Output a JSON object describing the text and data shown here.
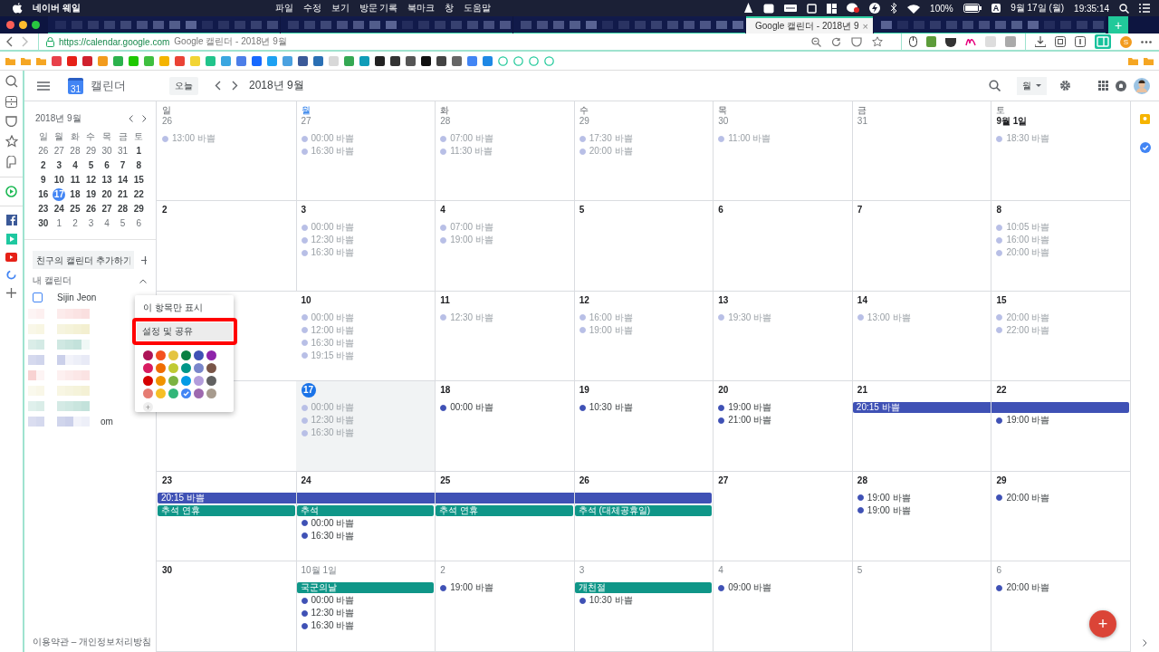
{
  "menubar": {
    "menus": [
      {
        "text": "네이버 웨일",
        "kind": "app"
      },
      {
        "text": "파일",
        "kind": "menu"
      },
      {
        "text": "수정",
        "kind": "menu"
      },
      {
        "text": "보기",
        "kind": "menu"
      },
      {
        "text": "방문 기록",
        "kind": "menu"
      },
      {
        "text": "북마크",
        "kind": "menu"
      },
      {
        "text": "창",
        "kind": "menu"
      },
      {
        "text": "도움말",
        "kind": "menu"
      }
    ],
    "battery": "100%",
    "input_source": "A",
    "date": "9월 17일 (월)",
    "time": "19:35:14"
  },
  "tabs": [
    {
      "kind": "blurred",
      "selected": false
    },
    {
      "kind": "blurred",
      "selected": false
    },
    {
      "kind": "blurred",
      "selected": false
    },
    {
      "kind": "page",
      "title": "Google 캘린더 - 2018년 9",
      "close": "×",
      "selected": true
    },
    {
      "kind": "blurred",
      "selected": false
    }
  ],
  "new_tab": "+",
  "address": {
    "url": "https://calendar.google.com",
    "title": "Google 캘린더 - 2018년 9월",
    "profile_initial": "S"
  },
  "header": {
    "logo_day": "31",
    "app_name": "캘린더",
    "today_button": "오늘",
    "period": "2018년 9월",
    "view": "월"
  },
  "mini_calendar": {
    "title": "2018년 9월",
    "weekdays": [
      "일",
      "월",
      "화",
      "수",
      "목",
      "금",
      "토"
    ],
    "days": [
      {
        "d": "26",
        "dim": true,
        "selected": false
      },
      {
        "d": "27",
        "dim": true,
        "selected": false
      },
      {
        "d": "28",
        "dim": true,
        "selected": false
      },
      {
        "d": "29",
        "dim": true,
        "selected": false
      },
      {
        "d": "30",
        "dim": true,
        "selected": false
      },
      {
        "d": "31",
        "dim": true,
        "selected": false
      },
      {
        "d": "1",
        "dim": false,
        "selected": false
      },
      {
        "d": "2",
        "dim": false,
        "selected": false
      },
      {
        "d": "3",
        "dim": false,
        "selected": false
      },
      {
        "d": "4",
        "dim": false,
        "selected": false
      },
      {
        "d": "5",
        "dim": false,
        "selected": false
      },
      {
        "d": "6",
        "dim": false,
        "selected": false
      },
      {
        "d": "7",
        "dim": false,
        "selected": false
      },
      {
        "d": "8",
        "dim": false,
        "selected": false
      },
      {
        "d": "9",
        "dim": false,
        "selected": false
      },
      {
        "d": "10",
        "dim": false,
        "selected": false
      },
      {
        "d": "11",
        "dim": false,
        "selected": false
      },
      {
        "d": "12",
        "dim": false,
        "selected": false
      },
      {
        "d": "13",
        "dim": false,
        "selected": false
      },
      {
        "d": "14",
        "dim": false,
        "selected": false
      },
      {
        "d": "15",
        "dim": false,
        "selected": false
      },
      {
        "d": "16",
        "dim": false,
        "selected": false
      },
      {
        "d": "17",
        "dim": false,
        "selected": true
      },
      {
        "d": "18",
        "dim": false,
        "selected": false
      },
      {
        "d": "19",
        "dim": false,
        "selected": false
      },
      {
        "d": "20",
        "dim": false,
        "selected": false
      },
      {
        "d": "21",
        "dim": false,
        "selected": false
      },
      {
        "d": "22",
        "dim": false,
        "selected": false
      },
      {
        "d": "23",
        "dim": false,
        "selected": false
      },
      {
        "d": "24",
        "dim": false,
        "selected": false
      },
      {
        "d": "25",
        "dim": false,
        "selected": false
      },
      {
        "d": "26",
        "dim": false,
        "selected": false
      },
      {
        "d": "27",
        "dim": false,
        "selected": false
      },
      {
        "d": "28",
        "dim": false,
        "selected": false
      },
      {
        "d": "29",
        "dim": false,
        "selected": false
      },
      {
        "d": "30",
        "dim": false,
        "selected": false
      },
      {
        "d": "1",
        "dim": true,
        "selected": false
      },
      {
        "d": "2",
        "dim": true,
        "selected": false
      },
      {
        "d": "3",
        "dim": true,
        "selected": false
      },
      {
        "d": "4",
        "dim": true,
        "selected": false
      },
      {
        "d": "5",
        "dim": true,
        "selected": false
      },
      {
        "d": "6",
        "dim": true,
        "selected": false
      }
    ]
  },
  "sidebar": {
    "add_friend_placeholder": "친구의 캘린더 추가하기",
    "my_calendars": "내 캘린더",
    "calendar": {
      "name": "Sijin Jeon",
      "checked": false
    },
    "trailing_text": "om",
    "footer": "이용약관 – 개인정보처리방침"
  },
  "popup": {
    "items": [
      {
        "text": "이 항목만 표시",
        "selected": false
      },
      {
        "text": "설정 및 공유",
        "selected": true
      }
    ],
    "colors": [
      {
        "color": "#ad1457",
        "selected": false
      },
      {
        "color": "#f4511e",
        "selected": false
      },
      {
        "color": "#e4c441",
        "selected": false
      },
      {
        "color": "#0b8043",
        "selected": false
      },
      {
        "color": "#3f51b5",
        "selected": false
      },
      {
        "color": "#8e24aa",
        "selected": false
      },
      {
        "color": "#d81b60",
        "selected": false
      },
      {
        "color": "#ef6c00",
        "selected": false
      },
      {
        "color": "#c0ca33",
        "selected": false
      },
      {
        "color": "#009688",
        "selected": false
      },
      {
        "color": "#7986cb",
        "selected": false
      },
      {
        "color": "#795548",
        "selected": false
      },
      {
        "color": "#d50000",
        "selected": false
      },
      {
        "color": "#f09300",
        "selected": false
      },
      {
        "color": "#7cb342",
        "selected": false
      },
      {
        "color": "#039be5",
        "selected": false
      },
      {
        "color": "#b39ddb",
        "selected": false
      },
      {
        "color": "#616161",
        "selected": false
      },
      {
        "color": "#e67c73",
        "selected": false
      },
      {
        "color": "#f6bf26",
        "selected": false
      },
      {
        "color": "#33b679",
        "selected": false
      },
      {
        "color": "#4285f4",
        "selected": true
      },
      {
        "color": "#9e69af",
        "selected": false
      },
      {
        "color": "#a79b8e",
        "selected": false
      }
    ],
    "add": "+"
  },
  "weekdays": [
    {
      "text": "일",
      "current": false
    },
    {
      "text": "월",
      "current": true
    },
    {
      "text": "화",
      "current": false
    },
    {
      "text": "수",
      "current": false
    },
    {
      "text": "목",
      "current": false
    },
    {
      "text": "금",
      "current": false
    },
    {
      "text": "토",
      "current": false
    }
  ],
  "weeks": [
    {
      "days": [
        {
          "date": "26",
          "dim": true,
          "today": false,
          "items": [
            {
              "kind": "event",
              "text": "13:00 바쁨",
              "faded": true
            }
          ]
        },
        {
          "date": "27",
          "dim": true,
          "today": false,
          "items": [
            {
              "kind": "event",
              "text": "00:00 바쁨",
              "faded": true
            },
            {
              "kind": "event",
              "text": "16:30 바쁨",
              "faded": true
            }
          ]
        },
        {
          "date": "28",
          "dim": true,
          "today": false,
          "items": [
            {
              "kind": "event",
              "text": "07:00 바쁨",
              "faded": true
            },
            {
              "kind": "event",
              "text": "11:30 바쁨",
              "faded": true
            }
          ]
        },
        {
          "date": "29",
          "dim": true,
          "today": false,
          "items": [
            {
              "kind": "event",
              "text": "17:30 바쁨",
              "faded": true
            },
            {
              "kind": "event",
              "text": "20:00 바쁨",
              "faded": true
            }
          ]
        },
        {
          "date": "30",
          "dim": true,
          "today": false,
          "items": [
            {
              "kind": "event",
              "text": "11:00 바쁨",
              "faded": true
            }
          ]
        },
        {
          "date": "31",
          "dim": true,
          "today": false
        },
        {
          "date": "9월 1일",
          "dim": false,
          "today": false,
          "items": [
            {
              "kind": "event",
              "text": "18:30 바쁨",
              "faded": true
            }
          ]
        }
      ]
    },
    {
      "days": [
        {
          "date": "2",
          "dim": false,
          "today": false
        },
        {
          "date": "3",
          "dim": false,
          "today": false,
          "items": [
            {
              "kind": "event",
              "text": "00:00 바쁨",
              "faded": true
            },
            {
              "kind": "event",
              "text": "12:30 바쁨",
              "faded": true
            },
            {
              "kind": "event",
              "text": "16:30 바쁨",
              "faded": true
            }
          ]
        },
        {
          "date": "4",
          "dim": false,
          "today": false,
          "items": [
            {
              "kind": "event",
              "text": "07:00 바쁨",
              "faded": true
            },
            {
              "kind": "event",
              "text": "19:00 바쁨",
              "faded": true
            }
          ]
        },
        {
          "date": "5",
          "dim": false,
          "today": false
        },
        {
          "date": "6",
          "dim": false,
          "today": false
        },
        {
          "date": "7",
          "dim": false,
          "today": false
        },
        {
          "date": "8",
          "dim": false,
          "today": false,
          "items": [
            {
              "kind": "event",
              "text": "10:05 바쁨",
              "faded": true
            },
            {
              "kind": "event",
              "text": "16:00 바쁨",
              "faded": true
            },
            {
              "kind": "event",
              "text": "20:00 바쁨",
              "faded": true
            }
          ]
        }
      ]
    },
    {
      "days": [
        {
          "date": "10",
          "dim": false,
          "today": false,
          "items": [
            {
              "kind": "event",
              "text": "00:00 바쁨",
              "faded": true
            },
            {
              "kind": "event",
              "text": "12:00 바쁨",
              "faded": true
            },
            {
              "kind": "event",
              "text": "16:30 바쁨",
              "faded": true
            },
            {
              "kind": "event",
              "text": "19:15 바쁨",
              "faded": true
            }
          ]
        },
        {
          "date": "11",
          "dim": false,
          "today": false,
          "items": [
            {
              "kind": "event",
              "text": "12:30 바쁨",
              "faded": true
            }
          ]
        },
        {
          "date": "12",
          "dim": false,
          "today": false,
          "items": [
            {
              "kind": "event",
              "text": "16:00 바쁨",
              "faded": true
            },
            {
              "kind": "event",
              "text": "19:00 바쁨",
              "faded": true
            }
          ]
        },
        {
          "date": "13",
          "dim": false,
          "today": false,
          "items": [
            {
              "kind": "event",
              "text": "19:30 바쁨",
              "faded": true
            }
          ]
        },
        {
          "date": "14",
          "dim": false,
          "today": false,
          "items": [
            {
              "kind": "event",
              "text": "13:00 바쁨",
              "faded": true
            }
          ]
        },
        {
          "date": "15",
          "dim": false,
          "today": false,
          "items": [
            {
              "kind": "event",
              "text": "20:00 바쁨",
              "faded": true
            },
            {
              "kind": "event",
              "text": "22:00 바쁨",
              "faded": true
            }
          ]
        }
      ]
    },
    {
      "days": [
        {
          "date": "17",
          "dim": false,
          "today": true,
          "items": [
            {
              "kind": "event",
              "text": "00:00 바쁨",
              "faded": true
            },
            {
              "kind": "event",
              "text": "12:30 바쁨",
              "faded": true
            },
            {
              "kind": "event",
              "text": "16:30 바쁨",
              "faded": true
            }
          ]
        },
        {
          "date": "18",
          "dim": false,
          "today": false,
          "items": [
            {
              "kind": "event",
              "text": "00:00 바쁨",
              "faded": false
            }
          ]
        },
        {
          "date": "19",
          "dim": false,
          "today": false,
          "items": [
            {
              "kind": "event",
              "text": "10:30 바쁨",
              "faded": false
            }
          ]
        },
        {
          "date": "20",
          "dim": false,
          "today": false,
          "items": [
            {
              "kind": "event",
              "text": "19:00 바쁨",
              "faded": false
            },
            {
              "kind": "event",
              "text": "21:00 바쁨",
              "faded": false
            }
          ]
        },
        {
          "date": "21",
          "dim": false,
          "today": false,
          "items": [
            {
              "kind": "bar",
              "text": "20:15 바쁨",
              "color": "#3f51b5"
            }
          ]
        },
        {
          "date": "22",
          "dim": false,
          "today": false,
          "items": [
            {
              "kind": "continue"
            },
            {
              "kind": "event",
              "text": "19:00 바쁨",
              "faded": false
            }
          ]
        }
      ]
    },
    {
      "days": [
        {
          "date": "23",
          "dim": false,
          "today": false,
          "items": [
            {
              "kind": "bar",
              "text": "20:15 바쁨",
              "color": "#3f51b5"
            },
            {
              "kind": "bar",
              "text": "추석 연휴",
              "color": "#0f9688"
            }
          ]
        },
        {
          "date": "24",
          "dim": false,
          "today": false,
          "items": [
            {
              "kind": "continue"
            },
            {
              "kind": "bar",
              "text": "추석",
              "color": "#0f9688"
            },
            {
              "kind": "event",
              "text": "00:00 바쁨",
              "faded": false
            },
            {
              "kind": "event",
              "text": "16:30 바쁨",
              "faded": false
            }
          ]
        },
        {
          "date": "25",
          "dim": false,
          "today": false,
          "items": [
            {
              "kind": "continue"
            },
            {
              "kind": "bar",
              "text": "추석 연휴",
              "color": "#0f9688"
            }
          ]
        },
        {
          "date": "26",
          "dim": false,
          "today": false,
          "items": [
            {
              "kind": "continue"
            },
            {
              "kind": "bar",
              "text": "추석 (대체공휴일)",
              "color": "#0f9688"
            }
          ]
        },
        {
          "date": "27",
          "dim": false,
          "today": false
        },
        {
          "date": "28",
          "dim": false,
          "today": false,
          "items": [
            {
              "kind": "event",
              "text": "19:00 바쁨",
              "faded": false
            },
            {
              "kind": "event",
              "text": "19:00 바쁨",
              "faded": false
            }
          ]
        },
        {
          "date": "29",
          "dim": false,
          "today": false,
          "items": [
            {
              "kind": "event",
              "text": "20:00 바쁨",
              "faded": false
            }
          ]
        }
      ]
    },
    {
      "days": [
        {
          "date": "30",
          "dim": false,
          "today": false
        },
        {
          "date": "10월 1일",
          "dim": true,
          "today": false,
          "items": [
            {
              "kind": "bar",
              "text": "국군의날",
              "color": "#0f9688"
            },
            {
              "kind": "event",
              "text": "00:00 바쁨",
              "faded": false
            },
            {
              "kind": "event",
              "text": "12:30 바쁨",
              "faded": false
            },
            {
              "kind": "event",
              "text": "16:30 바쁨",
              "faded": false
            }
          ]
        },
        {
          "date": "2",
          "dim": true,
          "today": false,
          "items": [
            {
              "kind": "event",
              "text": "19:00 바쁨",
              "faded": false
            }
          ]
        },
        {
          "date": "3",
          "dim": true,
          "today": false,
          "items": [
            {
              "kind": "bar",
              "text": "개천절",
              "color": "#0f9688"
            },
            {
              "kind": "event",
              "text": "10:30 바쁨",
              "faded": false
            }
          ]
        },
        {
          "date": "4",
          "dim": true,
          "today": false,
          "items": [
            {
              "kind": "event",
              "text": "09:00 바쁨",
              "faded": false
            }
          ]
        },
        {
          "date": "5",
          "dim": true,
          "today": false
        },
        {
          "date": "6",
          "dim": true,
          "today": false,
          "items": [
            {
              "kind": "event",
              "text": "20:00 바쁨",
              "faded": false
            }
          ]
        }
      ]
    }
  ],
  "fab": "+"
}
